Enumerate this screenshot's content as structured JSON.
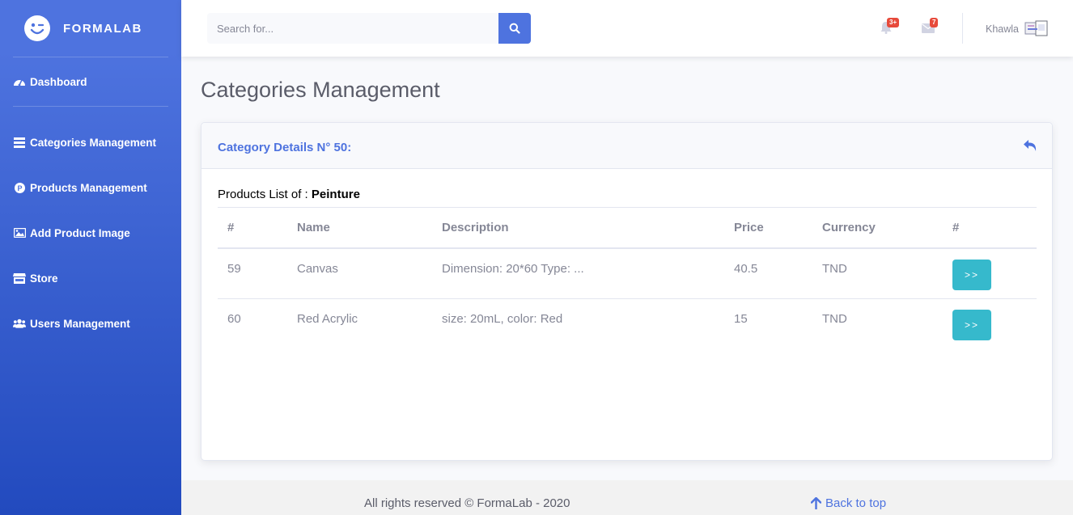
{
  "brand": {
    "name": "FORMALAB"
  },
  "sidebar": {
    "items": [
      {
        "label": "Dashboard",
        "icon": "tachometer-icon"
      },
      {
        "label": "Categories Management",
        "icon": "list-icon"
      },
      {
        "label": "Products Management",
        "icon": "product-icon"
      },
      {
        "label": "Add Product Image",
        "icon": "image-icon"
      },
      {
        "label": "Store",
        "icon": "store-icon"
      },
      {
        "label": "Users Management",
        "icon": "users-icon"
      }
    ]
  },
  "topbar": {
    "search_placeholder": "Search for...",
    "alerts_badge": "3+",
    "messages_badge": "7",
    "username": "Khawla"
  },
  "page": {
    "title": "Categories Management"
  },
  "card": {
    "title": "Category Details N° 50:",
    "list_prefix": "Products List of : ",
    "category_name": "Peinture",
    "columns": [
      "#",
      "Name",
      "Description",
      "Price",
      "Currency",
      "#"
    ],
    "rows": [
      {
        "id": "59",
        "name": "Canvas",
        "description": "Dimension: 20*60 Type: ...",
        "price": "40.5",
        "currency": "TND",
        "action": ">>"
      },
      {
        "id": "60",
        "name": "Red Acrylic",
        "description": "size: 20mL, color: Red",
        "price": "15",
        "currency": "TND",
        "action": ">>"
      }
    ]
  },
  "footer": {
    "copyright": "All rights reserved © FormaLab - 2020",
    "back_to_top": "Back to top"
  },
  "colors": {
    "primary": "#4e73df",
    "info": "#36b9cc",
    "danger": "#e74a3b"
  }
}
